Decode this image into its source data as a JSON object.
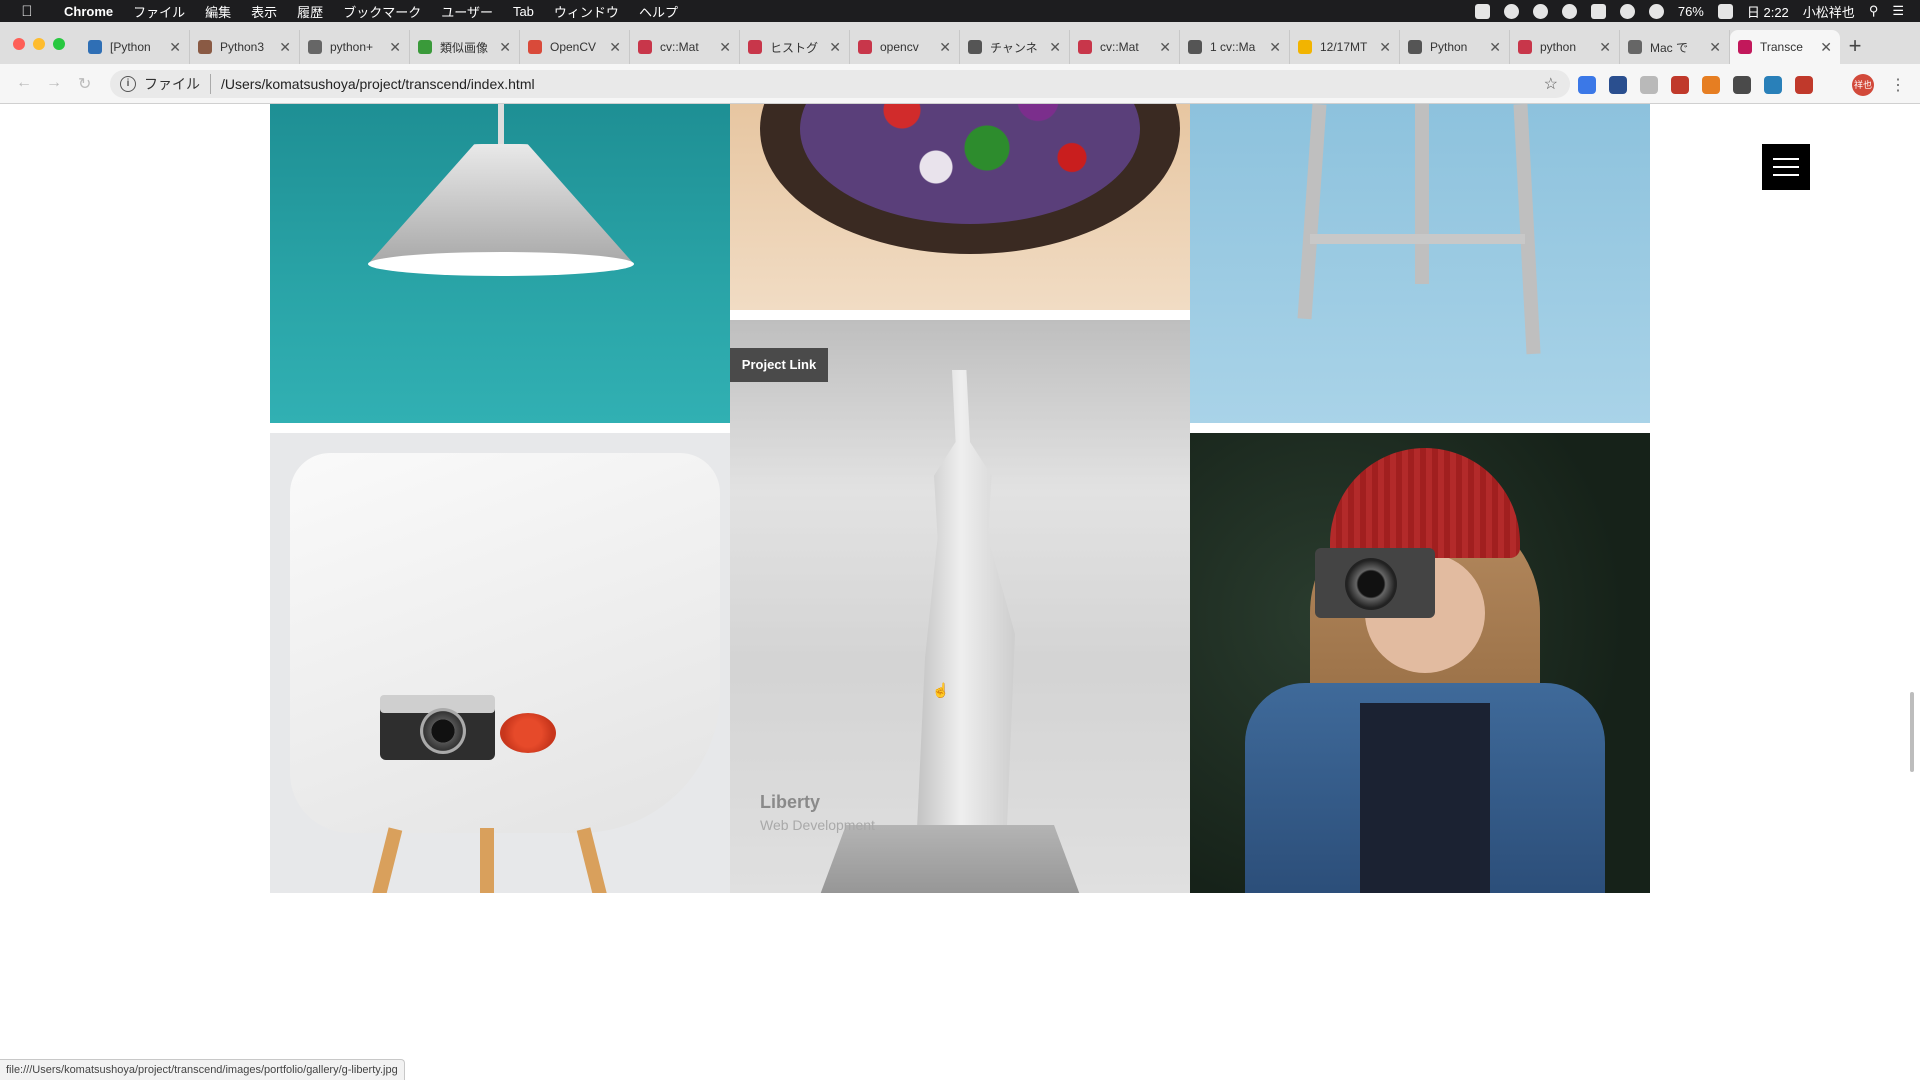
{
  "menubar": {
    "items": [
      "Chrome",
      "ファイル",
      "編集",
      "表示",
      "履歴",
      "ブックマーク",
      "ユーザー",
      "Tab",
      "ウィンドウ",
      "ヘルプ"
    ],
    "battery": "76%",
    "clock": "日 2:22",
    "user": "小松祥也"
  },
  "tabs": [
    {
      "title": "[Python",
      "color": "#2f6fb5"
    },
    {
      "title": "Python3",
      "color": "#8a5a44"
    },
    {
      "title": "python+",
      "color": "#666666"
    },
    {
      "title": "類似画像",
      "color": "#3a9a3a"
    },
    {
      "title": "OpenCV",
      "color": "#d94a3a"
    },
    {
      "title": "cv::Mat",
      "color": "#c8364a"
    },
    {
      "title": "ヒストグ",
      "color": "#c8364a"
    },
    {
      "title": "opencv",
      "color": "#c8364a"
    },
    {
      "title": "チャンネ",
      "color": "#555555"
    },
    {
      "title": "cv::Mat",
      "color": "#c8364a"
    },
    {
      "title": "1 cv::Ma",
      "color": "#555555"
    },
    {
      "title": "12/17MT",
      "color": "#f2b400"
    },
    {
      "title": "Python",
      "color": "#555555"
    },
    {
      "title": "python",
      "color": "#c8364a"
    },
    {
      "title": "Mac で",
      "color": "#666666"
    },
    {
      "title": "Transce",
      "color": "#c2185b",
      "active": true
    }
  ],
  "omnibox": {
    "scheme": "ファイル",
    "url": "/Users/komatsushoya/project/transcend/index.html"
  },
  "profile": {
    "label": "祥也"
  },
  "gallery": {
    "hover_tag": "Project Link",
    "hover_title": "Liberty",
    "hover_subtitle": "Web Development"
  },
  "statusbar": {
    "link": "file:///Users/komatsushoya/project/transcend/images/portfolio/gallery/g-liberty.jpg"
  }
}
